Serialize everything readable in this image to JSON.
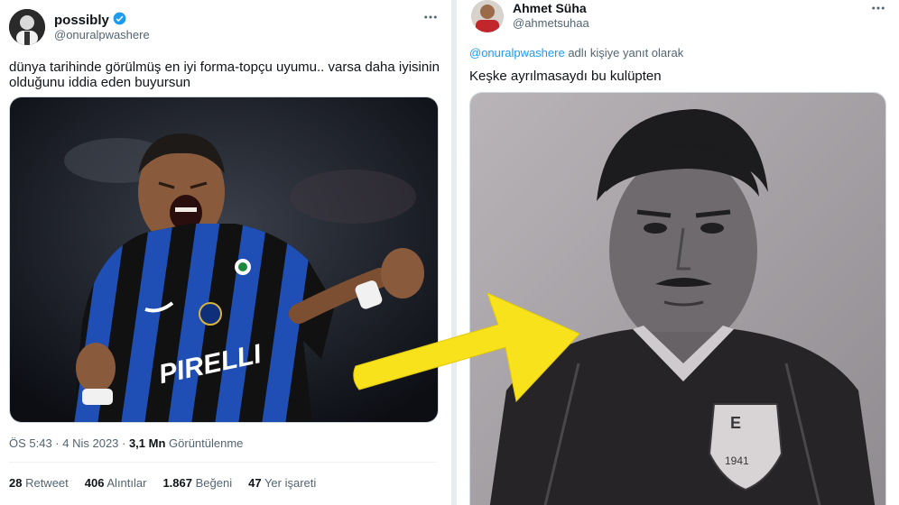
{
  "left_tweet": {
    "display_name": "possibly",
    "handle": "@onuralpwashere",
    "more_icon": "more-horizontal-icon",
    "text_line1": "dünya tarihinde görülmüş en iyi forma-topçu uyumu.. varsa daha iyisinin",
    "text_line2": "olduğunu iddia eden buyursun",
    "timestamp": "ÖS 5:43 · 4 Nis 2023 · ",
    "views_count": "3,1 Mn",
    "views_label": " Görüntülenme",
    "stats": {
      "retweets_count": "28",
      "retweets_label": " Retweet",
      "quotes_count": "406",
      "quotes_label": " Alıntılar",
      "likes_count": "1.867",
      "likes_label": " Beğeni",
      "bookmarks_count": "47",
      "bookmarks_label": " Yer işareti"
    },
    "shirt_sponsor": "PIRELLI"
  },
  "right_tweet": {
    "display_name": "Ahmet Süha",
    "handle": "@ahmetsuhaa",
    "more_icon": "more-horizontal-icon",
    "reply_mention": "@onuralpwashere",
    "reply_suffix": " adlı kişiye yanıt olarak",
    "text": "Keşke ayrılmasaydı bu kulüpten",
    "badge_text": "1941"
  },
  "colors": {
    "verified": "#1d9bf0",
    "link": "#1d9bf0",
    "secondary_text": "#536471",
    "arrow": "#f7e21b",
    "inter_blue": "#1f4fb4"
  }
}
